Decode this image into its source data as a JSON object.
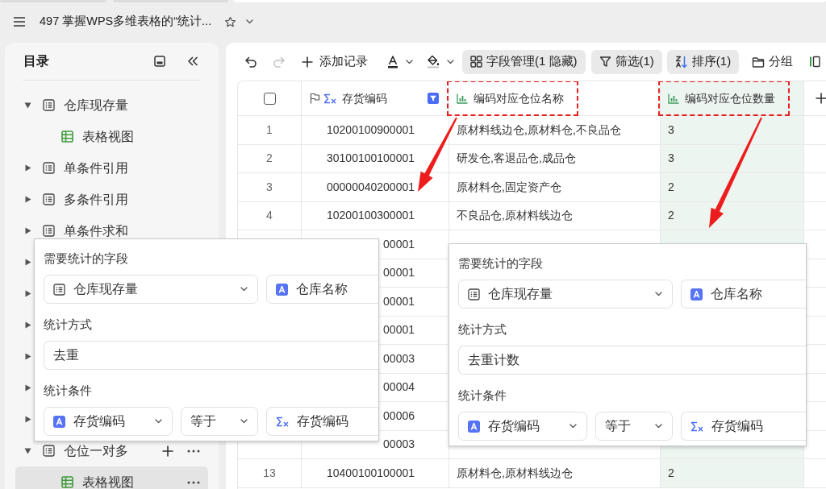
{
  "browser_tabs": [
    {
      "selected": false
    },
    {
      "selected": false
    },
    {
      "selected": true
    }
  ],
  "header": {
    "title": "497 掌握WPS多维表格的“统计...",
    "starred": false
  },
  "sidebar": {
    "title": "目录",
    "items": [
      {
        "label": "仓库现存量",
        "kind": "table",
        "expanded": true,
        "selected": false,
        "hovered": false,
        "children": [
          {
            "label": "表格视图",
            "kind": "view",
            "selected": false,
            "hovered": false
          }
        ]
      },
      {
        "label": "单条件引用",
        "kind": "table",
        "expanded": false,
        "selected": false,
        "hovered": false
      },
      {
        "label": "多条件引用",
        "kind": "table",
        "expanded": false,
        "selected": false,
        "hovered": false
      },
      {
        "label": "单条件求和",
        "kind": "table",
        "expanded": false,
        "selected": false,
        "hovered": false
      },
      {
        "expanded": false,
        "selected": false
      },
      {
        "expanded": false,
        "selected": false
      },
      {
        "expanded": false,
        "selected": false
      },
      {
        "expanded": false,
        "selected": false
      },
      {
        "expanded": false,
        "selected": false
      },
      {
        "expanded": false,
        "selected": false
      },
      {
        "label": "仓位一对多",
        "kind": "table",
        "expanded": true,
        "selected": false,
        "hovered": true,
        "children": [
          {
            "label": "表格视图",
            "kind": "view",
            "selected": true,
            "hovered": false
          }
        ]
      }
    ]
  },
  "toolbar": [
    {
      "kind": "undo",
      "disabled": false
    },
    {
      "kind": "redo",
      "disabled": true
    },
    {
      "kind": "add",
      "label": "添加记录"
    },
    {
      "kind": "text_color"
    },
    {
      "kind": "fill_color"
    },
    {
      "kind": "fields",
      "label": "字段管理(1 隐藏)",
      "active": true
    },
    {
      "kind": "filter",
      "label": "筛选(1)",
      "active": true
    },
    {
      "kind": "sort",
      "label": "排序(1)",
      "active": true
    },
    {
      "kind": "group",
      "label": "分组",
      "active": false
    },
    {
      "kind": "layout"
    }
  ],
  "table": {
    "columns": [
      {
        "kind": "checkbox",
        "checked": false,
        "selected": false
      },
      {
        "kind": "primary",
        "label": "存货编码",
        "filtered": true,
        "selected": false,
        "highlighted": false
      },
      {
        "kind": "stat",
        "label": "编码对应仓位名称",
        "filtered": false,
        "selected": false,
        "highlighted": true
      },
      {
        "kind": "stat",
        "label": "编码对应仓位数量",
        "filtered": false,
        "selected": true,
        "highlighted": true
      },
      {
        "kind": "add",
        "selected": false
      }
    ],
    "rows": [
      {
        "number": "1",
        "code": "10200100900001",
        "name": "原材料线边仓,原材料仓,不良品仓",
        "count": "3"
      },
      {
        "number": "2",
        "code": "30100100100001",
        "name": "研发仓,客退品仓,成品仓",
        "count": "3"
      },
      {
        "number": "3",
        "code": "00000040200001",
        "name": "原材料仓,固定资产仓",
        "count": "2"
      },
      {
        "number": "4",
        "code": "10200100300001",
        "name": "不良品仓,原材料线边仓",
        "count": "2"
      },
      {
        "code": "00001"
      },
      {
        "code": "00001"
      },
      {
        "code": "00001"
      },
      {
        "code": "00001"
      },
      {
        "code": "00003"
      },
      {
        "code": "00004"
      },
      {
        "code": "00006"
      },
      {
        "code": "00003"
      },
      {
        "number": "13",
        "code": "10400100100001",
        "name": "原材料仓,原材料线边仓",
        "count": "2"
      }
    ]
  },
  "annotations": [
    {
      "kind": "arrow"
    },
    {
      "kind": "arrow"
    }
  ],
  "popups": [
    {
      "sections": [
        {
          "label": "需要统计的字段",
          "fields": [
            {
              "kind": "table_select",
              "value": "仓库现存量"
            },
            {
              "kind": "text",
              "value": "仓库名称"
            }
          ]
        },
        {
          "label": "统计方式",
          "fields": [
            {
              "kind": "plain",
              "value": "去重"
            }
          ]
        },
        {
          "label": "统计条件",
          "fields": [
            {
              "kind": "text_select",
              "value": "存货编码"
            },
            {
              "kind": "select",
              "value": "等于"
            },
            {
              "kind": "formula",
              "value": "存货编码"
            }
          ]
        }
      ]
    },
    {
      "sections": [
        {
          "label": "需要统计的字段",
          "fields": [
            {
              "kind": "table_select",
              "value": "仓库现存量"
            },
            {
              "kind": "text",
              "value": "仓库名称"
            }
          ]
        },
        {
          "label": "统计方式",
          "fields": [
            {
              "kind": "plain",
              "value": "去重计数"
            }
          ]
        },
        {
          "label": "统计条件",
          "fields": [
            {
              "kind": "text_select",
              "value": "存货编码"
            },
            {
              "kind": "select",
              "value": "等于"
            },
            {
              "kind": "formula",
              "value": "存货编码"
            }
          ]
        }
      ]
    }
  ]
}
